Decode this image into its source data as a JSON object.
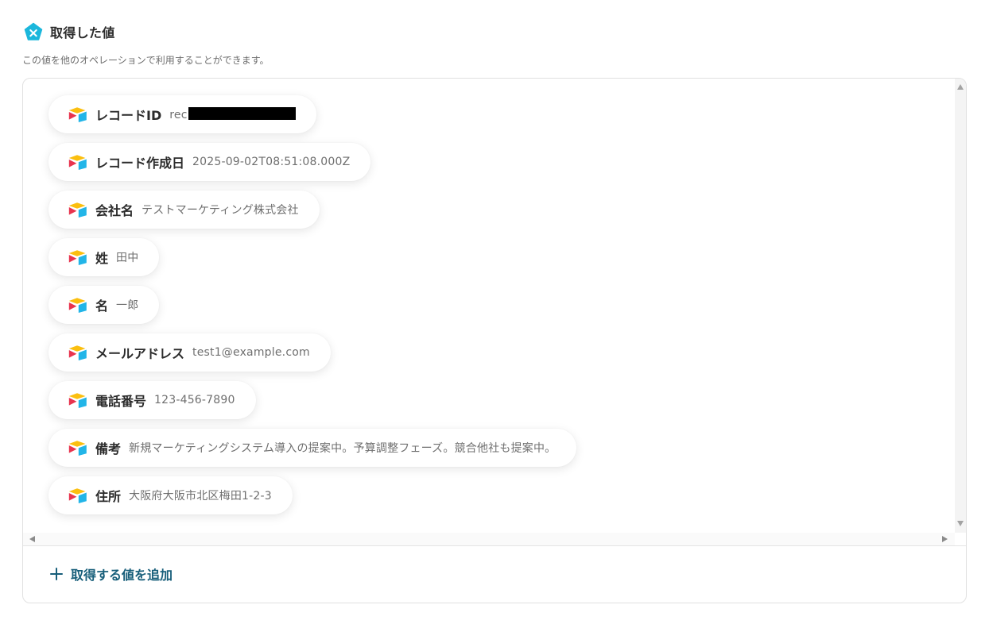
{
  "header": {
    "title": "取得した値",
    "subtitle": "この値を他のオペレーションで利用することができます。"
  },
  "fields": [
    {
      "label": "レコードID",
      "value": "rec",
      "redacted": true
    },
    {
      "label": "レコード作成日",
      "value": "2025-09-02T08:51:08.000Z"
    },
    {
      "label": "会社名",
      "value": "テストマーケティング株式会社"
    },
    {
      "label": "姓",
      "value": "田中"
    },
    {
      "label": "名",
      "value": "一郎"
    },
    {
      "label": "メールアドレス",
      "value": "test1@example.com"
    },
    {
      "label": "電話番号",
      "value": "123-456-7890"
    },
    {
      "label": "備考",
      "value": "新規マーケティングシステム導入の提案中。予算調整フェーズ。競合他社も提案中。"
    },
    {
      "label": "住所",
      "value": "大阪府大阪市北区梅田1-2-3"
    }
  ],
  "footer": {
    "add_label": "取得する値を追加"
  },
  "icons": {
    "header": "pentagon-x-icon",
    "field": "airtable-logo-icon",
    "add": "plus-icon"
  },
  "colors": {
    "accent": "#1bb7dc",
    "add_text": "#175e7a",
    "airtable_red": "#e8344e",
    "airtable_yellow": "#fbbf0f",
    "airtable_blue": "#22b5e8"
  }
}
